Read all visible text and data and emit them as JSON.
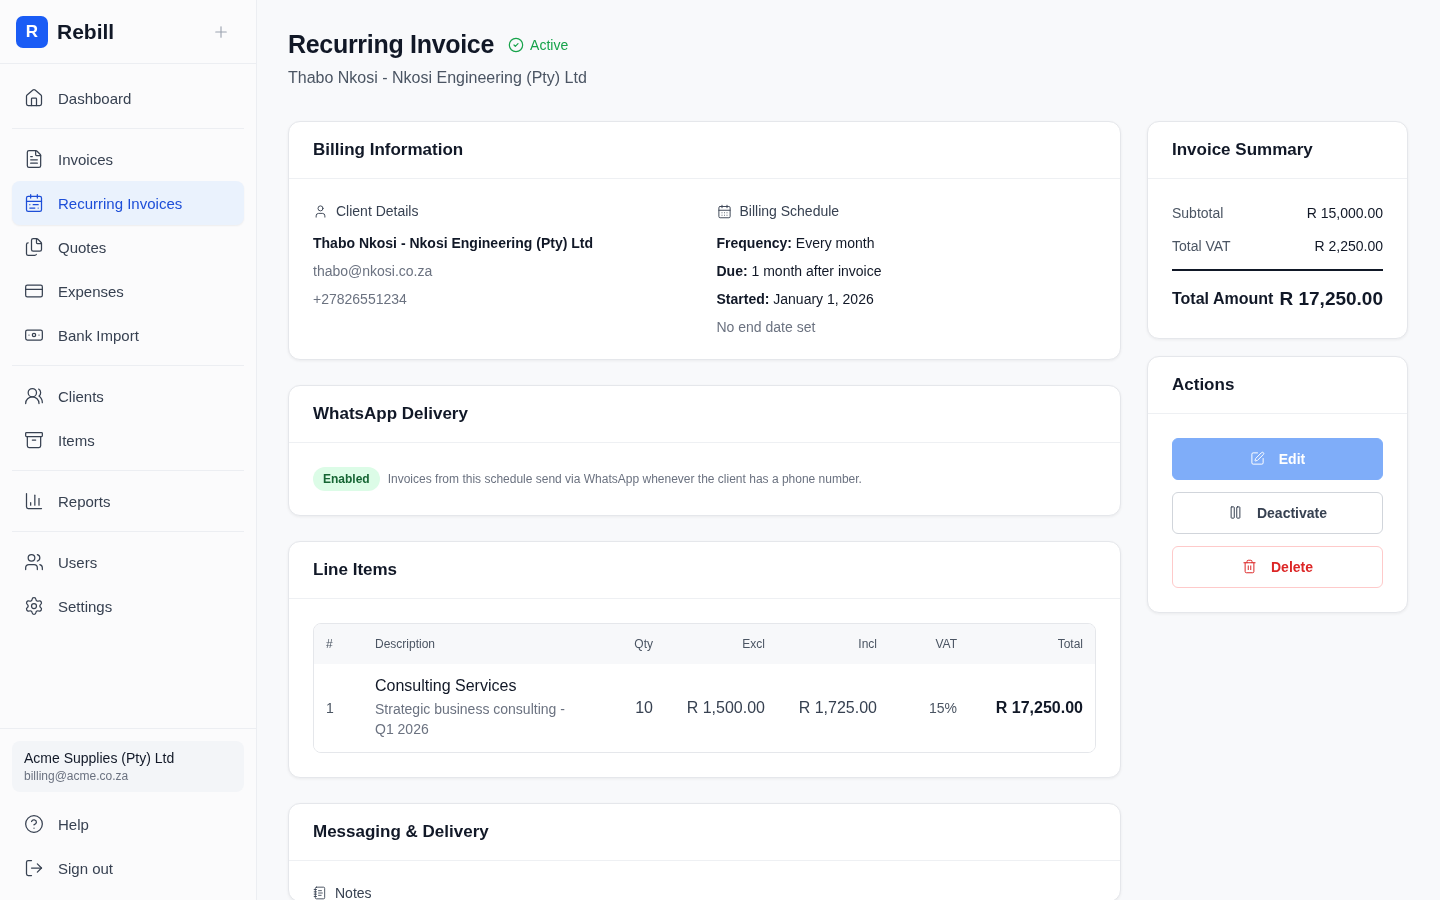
{
  "brand": {
    "letter": "R",
    "name": "Rebill"
  },
  "nav_groups": [
    [
      {
        "label": "Dashboard",
        "selected": false
      }
    ],
    [
      {
        "label": "Invoices",
        "selected": false
      },
      {
        "label": "Recurring Invoices",
        "selected": true
      },
      {
        "label": "Quotes",
        "selected": false
      },
      {
        "label": "Expenses",
        "selected": false
      },
      {
        "label": "Bank Import",
        "selected": false
      }
    ],
    [
      {
        "label": "Clients",
        "selected": false
      },
      {
        "label": "Items",
        "selected": false
      }
    ],
    [
      {
        "label": "Reports",
        "selected": false
      }
    ],
    [
      {
        "label": "Users",
        "selected": false
      },
      {
        "label": "Settings",
        "selected": false
      }
    ]
  ],
  "account": {
    "name": "Acme Supplies (Pty) Ltd",
    "email": "billing@acme.co.za"
  },
  "footer_links": [
    "Help",
    "Sign out"
  ],
  "page": {
    "title": "Recurring Invoice",
    "status": "Active",
    "subtitle": "Thabo Nkosi - Nkosi Engineering (Pty) Ltd"
  },
  "billing": {
    "title": "Billing Information",
    "client": {
      "heading": "Client Details",
      "name": "Thabo Nkosi - Nkosi Engineering (Pty) Ltd",
      "email": "thabo@nkosi.co.za",
      "phone": "+27826551234"
    },
    "schedule": {
      "heading": "Billing Schedule",
      "lines": [
        "**Frequency:** Every month",
        "**Due:** 1 month after invoice",
        "**Started:** January 1, 2026"
      ],
      "note": "No end date set"
    }
  },
  "whatsapp": {
    "title": "WhatsApp Delivery",
    "badge": "Enabled",
    "text": "Invoices from this schedule send via WhatsApp whenever the client has a phone number."
  },
  "line_items": {
    "title": "Line Items",
    "columns": [
      "#",
      "Description",
      "Qty",
      "Excl",
      "Incl",
      "VAT",
      "Total"
    ],
    "rows": [
      {
        "number": "1",
        "name": "Consulting Services",
        "description": "Strategic business consulting - Q1 2026",
        "qty": "10",
        "excl": "R 1,500.00",
        "incl": "R 1,725.00",
        "vat": "15%",
        "total": "R 17,250.00"
      }
    ]
  },
  "messaging": {
    "title": "Messaging & Delivery",
    "section": "Notes"
  },
  "summary": {
    "title": "Invoice Summary",
    "rows": [
      {
        "label": "Subtotal",
        "value": "R 15,000.00"
      },
      {
        "label": "Total VAT",
        "value": "R 2,250.00"
      }
    ],
    "total": {
      "label": "Total Amount",
      "value": "R 17,250.00"
    }
  },
  "actions": {
    "title": "Actions",
    "buttons": [
      {
        "label": "Edit",
        "kind": "primary",
        "disabled": true
      },
      {
        "label": "Deactivate",
        "kind": "outline",
        "disabled": false
      },
      {
        "label": "Delete",
        "kind": "danger",
        "disabled": false
      }
    ]
  }
}
